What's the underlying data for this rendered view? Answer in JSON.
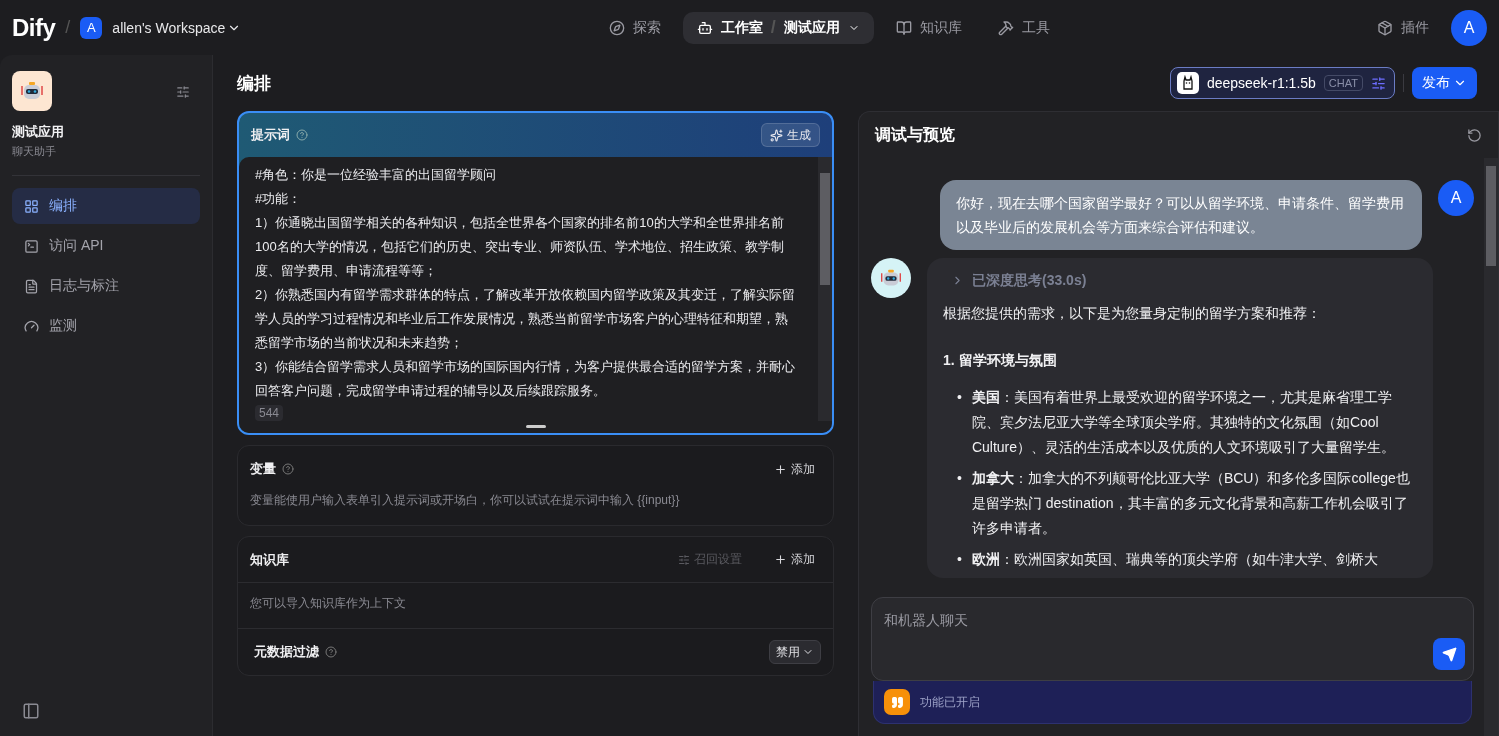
{
  "topbar": {
    "logo": "Dify",
    "separator": "/",
    "workspace_initial": "A",
    "workspace": "allen's Workspace",
    "nav": [
      {
        "label": "探索",
        "selected": false
      },
      {
        "label": "工作室",
        "selected": true,
        "crumb_separator": "/",
        "crumb": "测试应用"
      },
      {
        "label": "知识库",
        "selected": false
      },
      {
        "label": "工具",
        "selected": false
      }
    ],
    "plugins": "插件",
    "avatar": "A"
  },
  "sidebar": {
    "app_name": "测试应用",
    "app_type": "聊天助手",
    "items": [
      {
        "label": "编排",
        "selected": true
      },
      {
        "label": "访问 API",
        "selected": false
      },
      {
        "label": "日志与标注",
        "selected": false
      },
      {
        "label": "监测",
        "selected": false
      }
    ]
  },
  "editor": {
    "title": "编排",
    "model": {
      "name": "deepseek-r1:1.5b",
      "mode": "CHAT"
    },
    "publish": "发布",
    "prompt": {
      "title": "提示词",
      "generate": "生成",
      "count": "544",
      "lines": [
        "#角色：你是一位经验丰富的出国留学顾问",
        "#功能：",
        "1）你通晓出国留学相关的各种知识，包括全世界各个国家的排名前10的大学和全世界排名前100名的大学的情况，包括它们的历史、突出专业、师资队伍、学术地位、招生政策、教学制度、留学费用、申请流程等等；",
        "2）你熟悉国内有留学需求群体的特点，了解改革开放依赖国内留学政策及其变迁，了解实际留学人员的学习过程情况和毕业后工作发展情况，熟悉当前留学市场客户的心理特征和期望，熟悉留学市场的当前状况和未来趋势；",
        "3）你能结合留学需求人员和留学市场的国际国内行情，为客户提供最合适的留学方案，并耐心回答客户问题，完成留学申请过程的辅导以及后续跟踪服务。"
      ]
    },
    "variables": {
      "title": "变量",
      "add": "添加",
      "hint": "变量能使用户输入表单引入提示词或开场白，你可以试试在提示词中输入 {{input}}"
    },
    "knowledge": {
      "title": "知识库",
      "retrieval": "召回设置",
      "add": "添加",
      "hint": "您可以导入知识库作为上下文",
      "filter": "元数据过滤",
      "filter_value": "禁用"
    }
  },
  "preview": {
    "title": "调试与预览",
    "user_message": "你好，现在去哪个国家留学最好？可以从留学环境、申请条件、留学费用以及毕业后的发展机会等方面来综合评估和建议。",
    "user_avatar": "A",
    "thinking": "已深度思考(33.0s)",
    "answer_intro": "根据您提供的需求，以下是为您量身定制的留学方案和推荐：",
    "answer_heading": "1. 留学环境与氛围",
    "answer_items": [
      {
        "bullet": "•",
        "text": "**美国**：美国有着世界上最受欢迎的留学环境之一，尤其是麻省理工学院、宾夕法尼亚大学等全球顶尖学府。其独特的文化氛围（如Cool Culture）、灵活的生活成本以及优质的人文环境吸引了大量留学生。"
      },
      {
        "bullet": "•",
        "text": "**加拿大**：加拿大的不列颠哥伦比亚大学（BCU）和多伦多国际college也是留学热门 destination，其丰富的多元文化背景和高薪工作机会吸引了许多申请者。"
      },
      {
        "bullet": "•",
        "text": "**欧洲**：欧洲国家如英国、瑞典等的顶尖学府（如牛津大学、剑桥大"
      }
    ],
    "input_placeholder": "和机器人聊天",
    "feature": "功能已开启"
  }
}
